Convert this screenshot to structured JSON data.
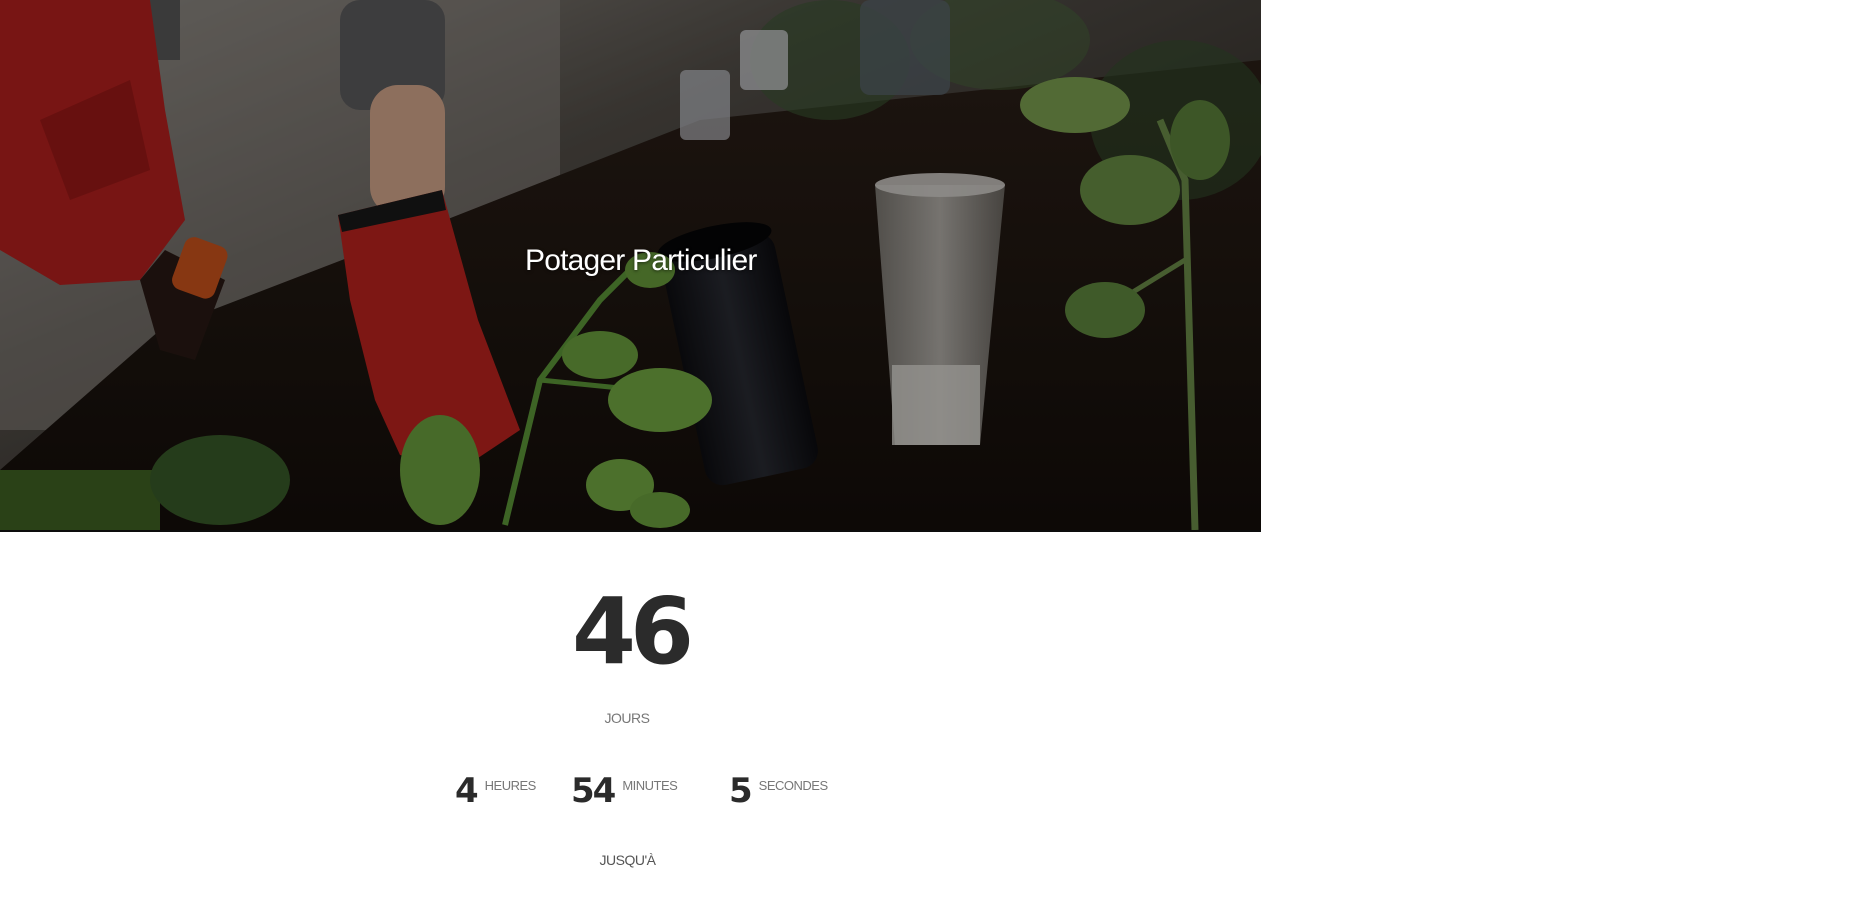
{
  "hero": {
    "title": "Potager Particulier"
  },
  "countdown": {
    "days": {
      "value": "46",
      "label": "JOURS"
    },
    "hours": {
      "value": "4",
      "label": "HEURES"
    },
    "minutes": {
      "value": "54",
      "label": "MINUTES"
    },
    "seconds": {
      "value": "5",
      "label": "SECONDES"
    },
    "until_label": "JUSQU'À"
  }
}
